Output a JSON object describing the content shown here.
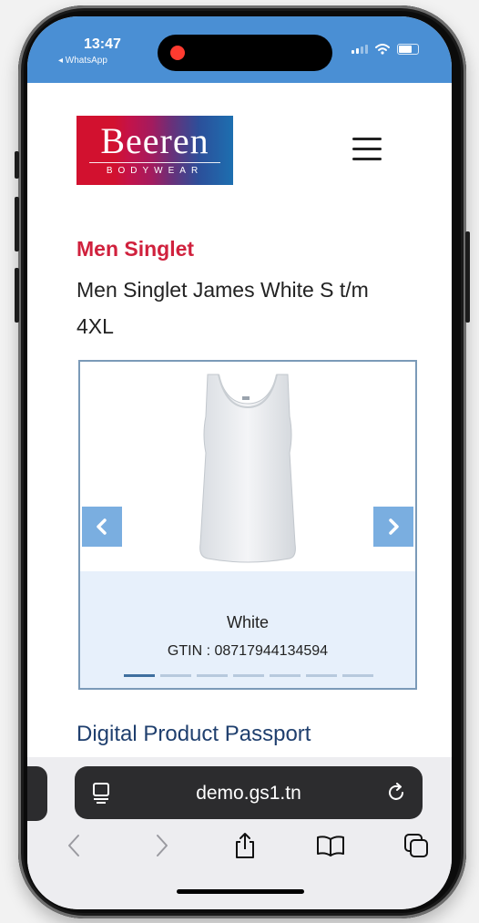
{
  "status_bar": {
    "time": "13:47",
    "back_app": "◂ WhatsApp"
  },
  "site": {
    "logo_word": "Beeren",
    "logo_sub": "BODYWEAR"
  },
  "product": {
    "category": "Men Singlet",
    "name": "Men Singlet James White S t/m 4XL"
  },
  "carousel": {
    "color": "White",
    "gtin": "GTIN : 08717944134594",
    "slide_count": 7,
    "active_slide": 1
  },
  "section": {
    "dpp_title": "Digital Product Passport"
  },
  "browser": {
    "url": "demo.gs1.tn"
  },
  "colors": {
    "status_bar": "#4a8fd4",
    "category_red": "#d0213d",
    "dpp_blue": "#1f3f6e",
    "arrow_bg": "#7aaee0",
    "caption_bg": "#e7f0fb"
  },
  "icons": {
    "hamburger": "menu-icon",
    "prev": "chevron-left-icon",
    "next": "chevron-right-icon",
    "tabs": "page-format-icon",
    "reload": "reload-icon",
    "back": "back-icon",
    "forward": "forward-icon",
    "share": "share-icon",
    "bookmarks": "bookmarks-icon",
    "tab_switch": "tabs-icon"
  }
}
